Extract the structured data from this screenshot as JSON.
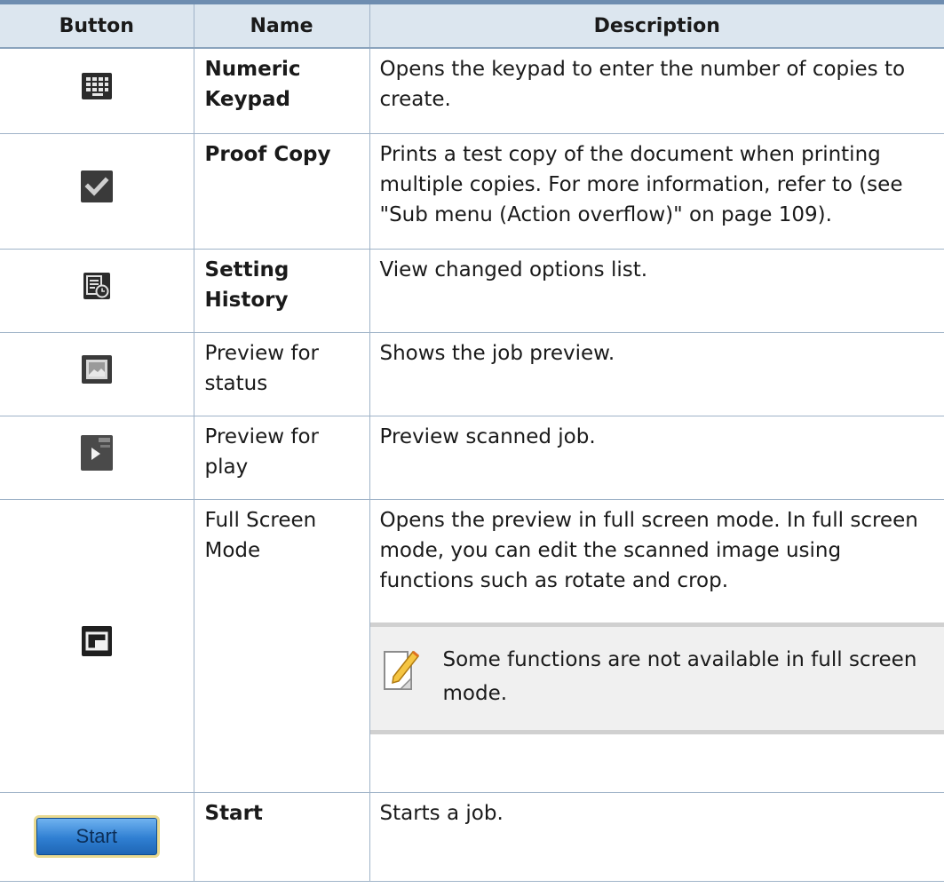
{
  "columns": {
    "button": "Button",
    "name": "Name",
    "description": "Description"
  },
  "rows": [
    {
      "icon": "numeric-keypad-icon",
      "name": "Numeric Keypad",
      "name_bold": true,
      "description": "Opens the keypad to enter the number of copies to create."
    },
    {
      "icon": "checkmark-icon",
      "name": "Proof Copy",
      "name_bold": true,
      "description": "Prints a test copy of the document when printing multiple copies. For more information, refer to (see \"Sub menu (Action overflow)\" on page 109)."
    },
    {
      "icon": "setting-history-icon",
      "name": "Setting History",
      "name_bold": true,
      "description": "View changed options list."
    },
    {
      "icon": "preview-image-icon",
      "name": "Preview for status",
      "name_bold": false,
      "description": "Shows the job preview."
    },
    {
      "icon": "play-icon",
      "name": "Preview for play",
      "name_bold": false,
      "description": "Preview scanned job."
    },
    {
      "icon": "full-screen-icon",
      "name": "Full Screen Mode",
      "name_bold": false,
      "description": "Opens the preview in full screen mode. In full screen mode, you can edit the scanned image using functions such as rotate and crop.",
      "note": "Some functions are not available in full screen mode."
    },
    {
      "icon": "start-button",
      "button_label": "Start",
      "name": "Start",
      "name_bold": true,
      "description": "Starts a job."
    }
  ],
  "colors": {
    "header_bg": "#dce6ef",
    "rule": "#9fb3c8",
    "icon_dark": "#2b2b2b",
    "start_blue": "#2f7fd2"
  }
}
